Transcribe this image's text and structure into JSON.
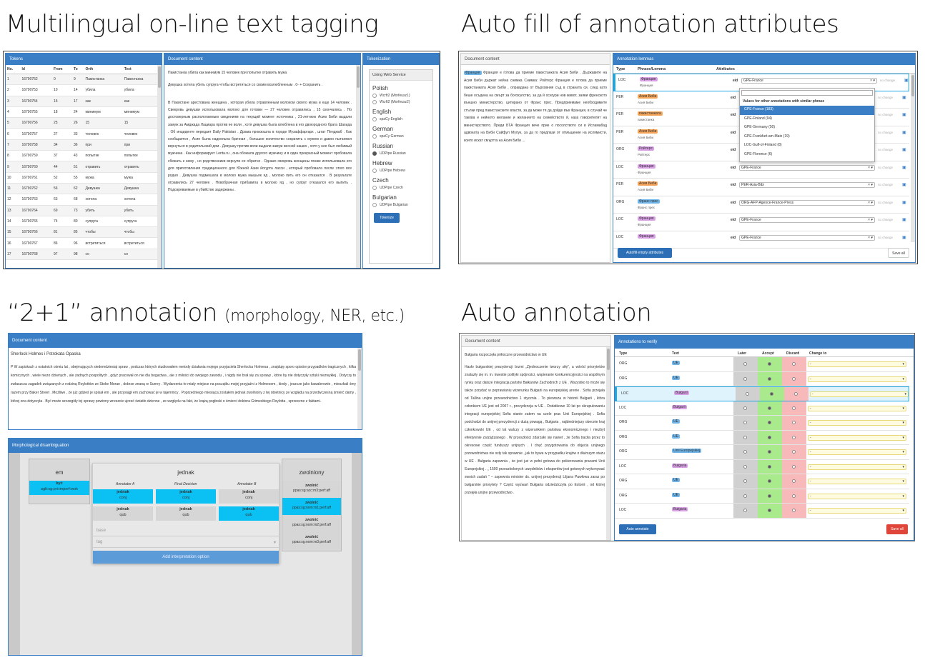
{
  "titles": {
    "tl": "Multilingual on-line text tagging",
    "tr": "Auto fill of annotation attributes",
    "bl_main": "“2+1” annotation",
    "bl_sub": "(morphology, NER, etc.)",
    "br": "Auto annotation"
  },
  "s1": {
    "tokens_header": "Tokens",
    "cols": [
      "No.",
      "Id",
      "From",
      "To",
      "Orth",
      "Text"
    ],
    "rows": [
      [
        "1",
        "16790752",
        "0",
        "9",
        "Пакистанка",
        "Пакистанка"
      ],
      [
        "2",
        "16790753",
        "10",
        "14",
        "убила",
        "убила"
      ],
      [
        "3",
        "16790754",
        "15",
        "17",
        "как",
        "как"
      ],
      [
        "4",
        "16790755",
        "18",
        "24",
        "минимум",
        "минимум"
      ],
      [
        "5",
        "16790756",
        "25",
        "26",
        "15",
        "15"
      ],
      [
        "6",
        "16790757",
        "27",
        "33",
        "человек",
        "человек"
      ],
      [
        "7",
        "16790758",
        "34",
        "36",
        "при",
        "при"
      ],
      [
        "8",
        "16790759",
        "37",
        "43",
        "попытке",
        "попытке"
      ],
      [
        "9",
        "16790760",
        "44",
        "51",
        "отравить",
        "отравить"
      ],
      [
        "10",
        "16790761",
        "52",
        "55",
        "мужа",
        "мужа"
      ],
      [
        "11",
        "16790762",
        "56",
        "62",
        "Девушка",
        "Девушка"
      ],
      [
        "12",
        "16790763",
        "63",
        "68",
        "хотела",
        "хотела"
      ],
      [
        "13",
        "16790764",
        "69",
        "73",
        "убить",
        "убить"
      ],
      [
        "14",
        "16790765",
        "74",
        "80",
        "супруга",
        "супруга"
      ],
      [
        "15",
        "16790766",
        "81",
        "85",
        "чтобы",
        "чтобы"
      ],
      [
        "16",
        "16790767",
        "86",
        "96",
        "встретиться",
        "встретиться"
      ],
      [
        "17",
        "16790768",
        "97",
        "98",
        "со",
        "со"
      ]
    ],
    "doc_header": "Document content",
    "doc_line1": "Пакистанка убила как минимум 15 человек при попытке отравить мужа",
    "doc_line2": "Девушка хотела убить супруга чтобы встретиться со своим возлюбленным . 0- + Сохранить .",
    "doc_body": "В Пакистане арестована женщина , которая убила отравленным молоком своего мужа и еще 14 человек . Свекровь девушки использовала молоко для готовки — 27 человек отравились , 15 скончались . По достоверным распологаемым сведениям на текущий момент источника , 21-летнюю Асию Биби выдали замуж за Амджада Лациара против ее воли , хотя девушка была влюблена в его двоюродного брата Шахида . Об инциденте передает Daily Pakistan . Драма произошла в городе Музаффаргарх , штат Пенджаб . Как сообщается , Асие была надоельна брачная , большое количество сократить с мужем и давно пытаемся вернуться в родительский дом . Девушку против воли выдали замуж весной наших , хотя у нее был любимый мужчина . Как информирует Lenta.ru , она обожала другого мужчину и в один прекрасный момент пробовала сбежать к нему , но родственники вернули ее обратно . Однако свекровь женщины позже использовала его для приготовления традиционного для Южной Азии йогурта ласси , который пробовала после этого все родня . Девушка подмешала в молоко мужа мышьяк яд , молоко пить его он отказался . В результате отравились 27 человек . Новобрачная прибавила в молоко яд , но супруг отказался его выпить . Подозреваемые в убийстве задержаны .",
    "tok_header": "Tokenization",
    "webservice": "Using Web Service",
    "groups": [
      {
        "name": "Polish",
        "opts": [
          {
            "l": "Wcrft2 (Morfeusz1)",
            "on": false
          },
          {
            "l": "Wcrft2 (Morfeusz2)",
            "on": false
          }
        ]
      },
      {
        "name": "English",
        "opts": [
          {
            "l": "spaCy English",
            "on": false
          }
        ]
      },
      {
        "name": "German",
        "opts": [
          {
            "l": "spaCy German",
            "on": false
          }
        ]
      },
      {
        "name": "Russian",
        "opts": [
          {
            "l": "UDPipe Russian",
            "on": true
          }
        ]
      },
      {
        "name": "Hebrew",
        "opts": [
          {
            "l": "UDPipe Hebrew",
            "on": false
          }
        ]
      },
      {
        "name": "Czech",
        "opts": [
          {
            "l": "UDPipe Czech",
            "on": false
          }
        ]
      },
      {
        "name": "Bulgarian",
        "opts": [
          {
            "l": "UDPipe Bulgarian",
            "on": false
          }
        ]
      }
    ],
    "tokenize": "Tokenize"
  },
  "s2": {
    "doc_header": "Document content",
    "doc_text": "Франция е готова да приеме пакистанката Асия Биби . Държавите на Асия Биби държат нейна снимка Снимка: Ройтерс Франция е готова да приеме пакистанката Асия Биби , оправдана от Върховния съд в страната си, след като беше осъдена на смърт за богохулство, за да й осигури нов живот, заяви френското външно министерство, цитирано от Франс прес. Предприемаме необходимите стъпки пред пакистанските власти, за да може тя да дойде във Франция, в случай че такова е нейното желание и желанието на семейството й, каза говорителят на министерството. Преди БТА Франция вече прие о посолството си в Исламабад адвоката на Биби Сайфул Мулук, за да го предпази от отмъщение на ислямисти, които искат смъртта на Асия Биби ...",
    "ann_header": "Annotation lemmas",
    "cols": [
      "Type",
      "Phrase/Lemma",
      "Attributes"
    ],
    "rows": [
      {
        "type": "LOC",
        "phrase": "Франция",
        "lemma": "Франция",
        "cls": "t-per",
        "val": "GPE-France",
        "change": "no change"
      },
      {
        "type": "PER",
        "phrase": "Асия Биби",
        "lemma": "Асия Биби",
        "cls": "t-org",
        "val": "",
        "change": "no change"
      },
      {
        "type": "PER",
        "phrase": "пакистанката",
        "lemma": "пакистанка",
        "cls": "t-org",
        "val": "",
        "change": "no change"
      },
      {
        "type": "PER",
        "phrase": "Асия Биби",
        "lemma": "Асия Биби",
        "cls": "t-org",
        "val": "",
        "change": "no change"
      },
      {
        "type": "ORG",
        "phrase": "Ройтерс",
        "lemma": "Ройтерс",
        "cls": "t-per",
        "val": "",
        "change": "no change"
      },
      {
        "type": "LOC",
        "phrase": "Франция",
        "lemma": "Франция",
        "cls": "t-per",
        "val": "GPE-France",
        "change": "no change"
      },
      {
        "type": "PER",
        "phrase": "Асия Биби",
        "lemma": "Асия Биби",
        "cls": "t-org",
        "val": "PER-Asia-Bibi",
        "change": "no change"
      },
      {
        "type": "ORG",
        "phrase": "Франс прес",
        "lemma": "Франс прес",
        "cls": "t-loc",
        "val": "ORG-AFP-Agence-France-Press",
        "change": "no change"
      },
      {
        "type": "LOC",
        "phrase": "Франция",
        "lemma": "Франция",
        "cls": "t-per",
        "val": "GPE-France",
        "change": "no change"
      },
      {
        "type": "LOC",
        "phrase": "Франция",
        "lemma": "",
        "cls": "t-per",
        "val": "GPE-France",
        "change": "no change"
      }
    ],
    "attr_label": "eid",
    "dropdown_title": "Values for other annotations with similar phrase",
    "dropdown": [
      "GPE-France (183)",
      "GPE-Finland (94)",
      "GPE-Germany (50)",
      "GPE-Frankfurt-am-Main (19)",
      "LOC-Gulf-of-Finland (8)",
      "GPE-Florence (6)"
    ],
    "autofill": "Autofill empty attributes",
    "saveall": "Save all"
  },
  "s3": {
    "doc_header": "Document content",
    "doc_title": "Sherlock Holmes i Pstrokata Opaska",
    "doc_text": "P W zapiskach z ostatnich ośmiu lat , obejmujących siedemdziesiąt spraw , podczas których studiowałem metody działania mojego przyjaciela Sherlocka Holmesa , znajduję sporo opisów przypadków tragicznych , kilka komicznych , wiele niezo dziwnych , ale żadnych pospolitych , gdyż pracował on nie dla bogactwa , ale z miłości do swojego zawodu , i nigdy nie brał się za sprawy , które by nie dotyczyły sztuki niezwykłej . Dotyczy to zwłaszcza zagadek związanych z rodziną Roylottów ze Stoke Moran , dobrze znaną w Surrey . Wydarzenia te miały miejsce na początku mojej przyjaźni z Holmesem , kiedy , jeszcze jako kawalerowie , mieszkali śmy razem przy Baker Street . Możliwe , że już gdzieś je spisał em , ale przysiągł em zachować je w tajemnicy . Poprzedniego miesiąca zostałem jednak zwolniony z tej obietnicy ze względu na przedwczesną śmierć damy , której ona dotyczyła . Być może szczegóły tej sprawy powinny wreszcie ujrzeć światło dzienne , ze względu na fakt, że krążą pogłoski o śmierci doktora Grimesbiego Roylotta , sprzeczne z faktami.",
    "morph_header": "Morphological disambiguation",
    "w_left": "em",
    "w_left_opt1": "być",
    "w_left_opt2": "aglt:sg:pri:imperf:wok",
    "w_center": "jednak",
    "ann_a": "Annotator A",
    "final": "Final Decision",
    "ann_b": "Annotator B",
    "opt_row1_a": "jednak",
    "opt_row1_a_t": "conj",
    "opt_row1_f": "jednak",
    "opt_row1_f_t": "conj",
    "opt_row1_b": "jednak",
    "opt_row1_b_t": "conj",
    "opt_row2_a": "jednak",
    "opt_row2_a_t": "qub",
    "opt_row2_f": "jednak",
    "opt_row2_f_t": "qub",
    "opt_row2_b": "jednak",
    "opt_row2_b_t": "qub",
    "base_ph": "base",
    "tag_ph": "tag",
    "add_interp": "Add interpretation option",
    "w_right": "zwolniony",
    "w_right_opts": [
      {
        "w": "zwolnić",
        "t": "ppas:sg:acc:m3:perf:aff",
        "on": false
      },
      {
        "w": "zwolnić",
        "t": "ppas:sg:nom:m1:perf:aff",
        "on": true
      },
      {
        "w": "zwolnić",
        "t": "ppas:sg:nom:m2:perf:aff",
        "on": false
      },
      {
        "w": "zwolnić",
        "t": "ppas:sg:nom:m3:perf:aff",
        "on": false
      }
    ]
  },
  "s4": {
    "doc_header": "Document content",
    "doc_first": "Bułgaria rozpoczęła półroczne przewodnictwo w UE",
    "doc_text": "Hasło bułgarskiej prezydencji brzmi „Zjednoczenie tworzy siłę”, a wśród priorytetów znalazły się m. in. kwestie polityki spójności, wspieranie konkurencyjności na wspólnym rynku oraz dalsze integracja państw Bałkanów Zachodnich z UE . Wszystko to może się także przydać w poprawianiu wizerunku Bułgarii na europejskiej arenie . Sofia przejęła od Tallina unijne przewodnictwo 1 stycznia . To pierwsza w historii Bułgarii , która członkiem UE jest od 2007 r., prezydencja w UE . Dodatkowe 10 lat po skrupulowaniu integracji europejskiej Sofia stanie zatem na czele prac Unii Europejskiej . Sofia podchodzi do unijnej prezydencji z dużą powagą , Bułgaria , najbiedniejszy obecnie kraj członkowski UE , od lat walczy z wizerunkiem państwa ekonomicznego i niezbyt efektywnie zarządzanego . W przeszłości zdarzało się nawet , że Sofia traciła przez to okresowe część funduszy unijnych . I chęć przygotowania do objęcia unijnego przewodnictwa nie szły tak sprawnie , jak to bywa w przypadku krajów o dłuższym stażu w UE . Bułgaria zapewnia , że jest już w pełni gotowa do pokierowania pracami Unii Europejskiej . „ 1500 przeszkolonych urzędników i ekspertów jest gotowych wykonywać swoich zadań ” – zapewnia minister ds. unijnej prezydencji Liljana Pawłowa zaraz po bułgarskie priorytety ? Część wyzwań Bułgaria odziedziczyła po Estonii , od której przejęła unijne przewodnictwo .",
    "verify_header": "Annotations to verify",
    "cols": [
      "Type",
      "Text",
      "Later",
      "Accept",
      "Discard",
      "Change to"
    ],
    "rows": [
      {
        "type": "ORG",
        "text": "UE",
        "cls": "t-loc",
        "sel": "accept",
        "hl": false
      },
      {
        "type": "ORG",
        "text": "UE",
        "cls": "t-loc",
        "sel": "accept",
        "hl": false
      },
      {
        "type": "LOC",
        "text": "Bułgarii",
        "cls": "t-per",
        "sel": "accept",
        "hl": true
      },
      {
        "type": "LOC",
        "text": "Bułgarii",
        "cls": "t-per",
        "sel": "accept",
        "hl": false
      },
      {
        "type": "ORG",
        "text": "UE",
        "cls": "t-loc",
        "sel": "accept",
        "hl": false
      },
      {
        "type": "ORG",
        "text": "UE",
        "cls": "t-loc",
        "sel": "accept",
        "hl": false
      },
      {
        "type": "ORG",
        "text": "Unii Europejskiej",
        "cls": "t-loc",
        "sel": "accept",
        "hl": false
      },
      {
        "type": "LOC",
        "text": "Bułgaria",
        "cls": "t-per",
        "sel": "accept",
        "hl": false
      },
      {
        "type": "ORG",
        "text": "UE",
        "cls": "t-loc",
        "sel": "accept",
        "hl": false
      },
      {
        "type": "ORG",
        "text": "UE",
        "cls": "t-loc",
        "sel": "accept",
        "hl": false
      },
      {
        "type": "LOC",
        "text": "Bułgaria",
        "cls": "t-per",
        "sel": "accept",
        "hl": false
      }
    ],
    "change_default": "-",
    "auto_annotate": "Auto annotate",
    "saveall": "Save all"
  }
}
